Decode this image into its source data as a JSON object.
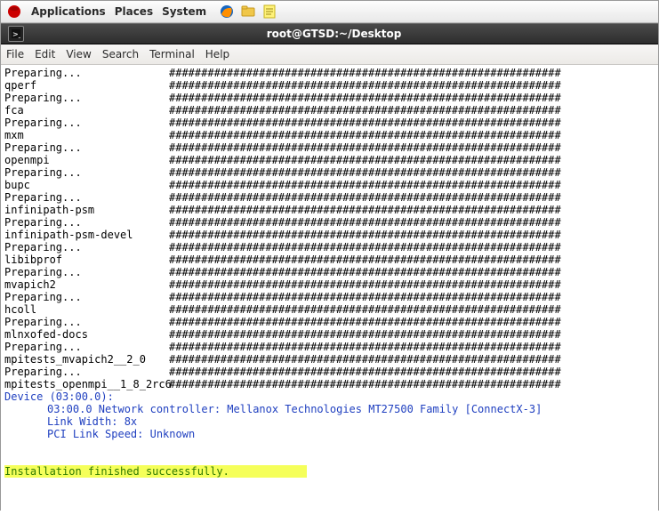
{
  "panel": {
    "applications": "Applications",
    "places": "Places",
    "system": "System"
  },
  "titlebar": {
    "title": "root@GTSD:~/Desktop"
  },
  "menubar": {
    "file": "File",
    "edit": "Edit",
    "view": "View",
    "search": "Search",
    "terminal": "Terminal",
    "help": "Help"
  },
  "hashes": "#############################################################",
  "lines": [
    "Preparing...",
    "qperf",
    "Preparing...",
    "fca",
    "Preparing...",
    "mxm",
    "Preparing...",
    "openmpi",
    "Preparing...",
    "bupc",
    "Preparing...",
    "infinipath-psm",
    "Preparing...",
    "infinipath-psm-devel",
    "Preparing...",
    "libibprof",
    "Preparing...",
    "mvapich2",
    "Preparing...",
    "hcoll",
    "Preparing...",
    "mlnxofed-docs",
    "Preparing...",
    "mpitests_mvapich2__2_0",
    "Preparing...",
    "mpitests_openmpi__1_8_2rc6"
  ],
  "device": {
    "header": "Device (03:00.0):",
    "l1": "03:00.0 Network controller: Mellanox Technologies MT27500 Family [ConnectX-3]",
    "l2": "Link Width: 8x",
    "l3": "PCI Link Speed: Unknown"
  },
  "success": "Installation finished successfully."
}
